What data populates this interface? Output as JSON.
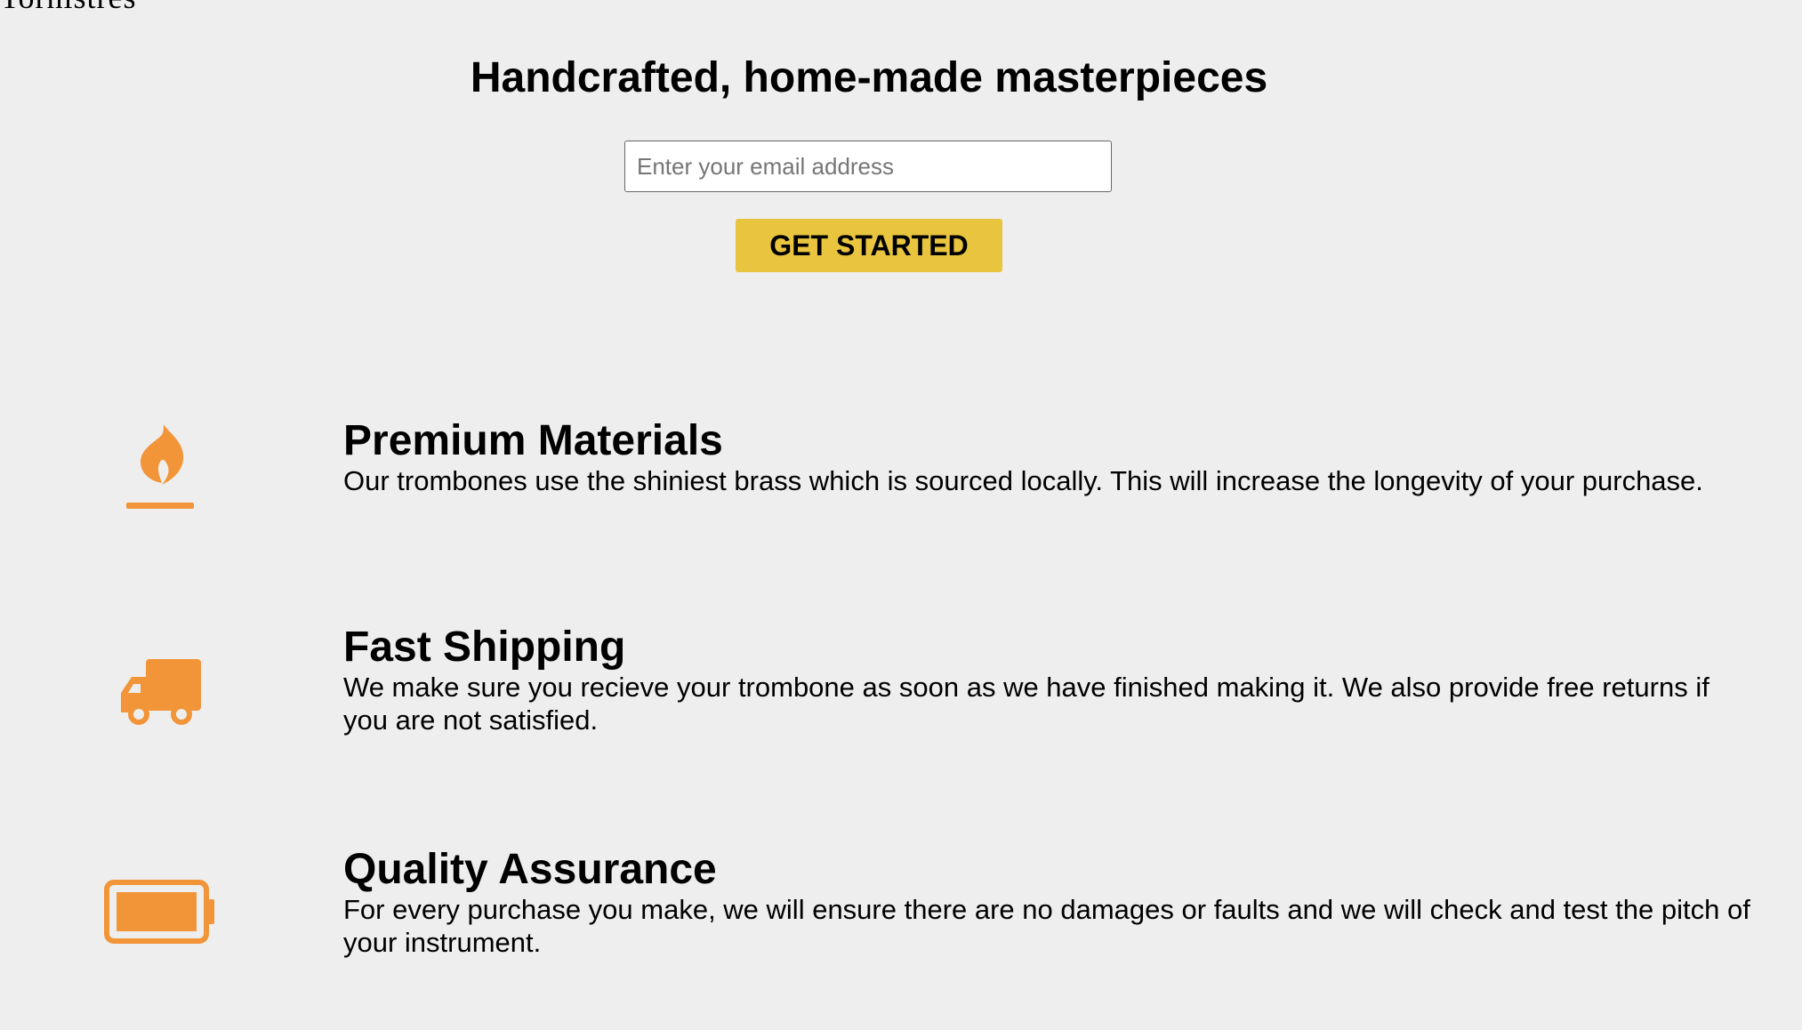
{
  "header": {
    "logo_fragment": "Tornistres"
  },
  "hero": {
    "title": "Handcrafted, home-made masterpieces",
    "email_placeholder": "Enter your email address",
    "cta_label": "GET STARTED"
  },
  "features": [
    {
      "icon": "flame-icon",
      "title": "Premium Materials",
      "description": "Our trombones use the shiniest brass which is sourced locally. This will increase the longevity of your purchase."
    },
    {
      "icon": "truck-icon",
      "title": "Fast Shipping",
      "description": "We make sure you recieve your trombone as soon as we have finished making it. We also provide free returns if you are not satisfied."
    },
    {
      "icon": "battery-icon",
      "title": "Quality Assurance",
      "description": "For every purchase you make, we will ensure there are no damages or faults and we will check and test the pitch of your instrument."
    }
  ],
  "colors": {
    "background": "#eeeeee",
    "accent_icon": "#f29539",
    "cta_background": "#e8c43f"
  }
}
